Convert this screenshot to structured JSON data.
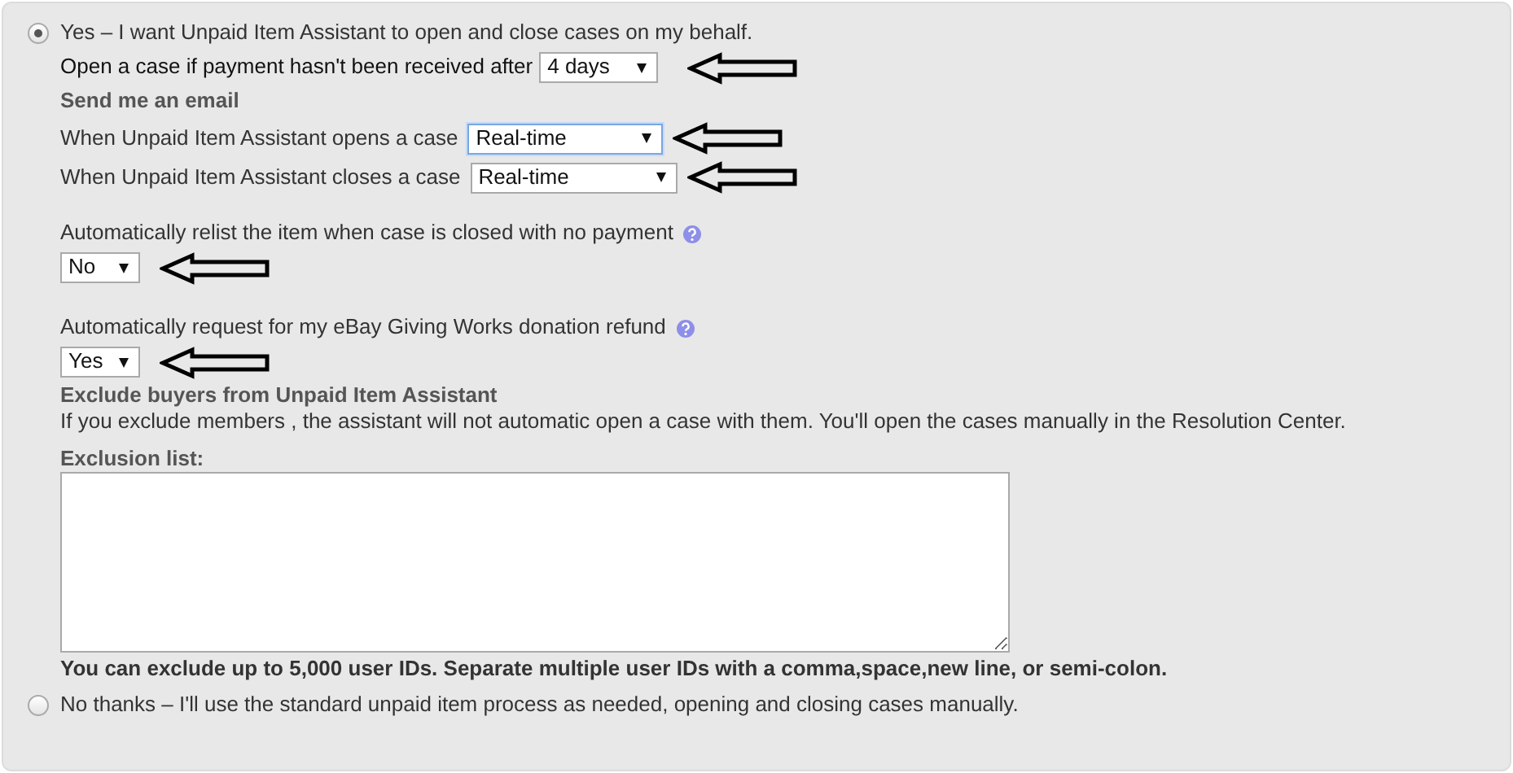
{
  "options": [
    {
      "kind": "yes",
      "label": "Yes – I want Unpaid Item Assistant to open and close cases on my behalf.",
      "selected": true
    },
    {
      "kind": "no",
      "label": "No thanks – I'll use the standard unpaid item process as needed, opening and closing cases manually.",
      "selected": false
    }
  ],
  "open_case": {
    "label": "Open a case if payment hasn't been received after",
    "value": "4 days",
    "focused": false,
    "annotated": true
  },
  "email": {
    "heading": "Send me an email",
    "rows": [
      {
        "label": "When Unpaid Item Assistant opens a case",
        "value": "Real-time",
        "focused": true,
        "annotated": true
      },
      {
        "label": "When Unpaid Item Assistant closes a case",
        "value": "Real-time",
        "focused": false,
        "annotated": true
      }
    ]
  },
  "settings": [
    {
      "label": "Automatically relist the item when case is closed with no payment",
      "help": true,
      "value": "No",
      "focused": false,
      "annotated": true
    },
    {
      "label": "Automatically request for my eBay Giving Works donation refund",
      "help": true,
      "value": "Yes",
      "focused": false,
      "annotated": true
    }
  ],
  "exclude": {
    "heading": "Exclude buyers from Unpaid Item Assistant",
    "text": "If you exclude members , the assistant will not automatic open a case with them. You'll open the cases manually in the Resolution Center.",
    "list_label": "Exclusion list:",
    "note": "You can exclude up to 5,000 user IDs. Separate multiple user IDs with a comma,space,new line, or semi-colon."
  }
}
